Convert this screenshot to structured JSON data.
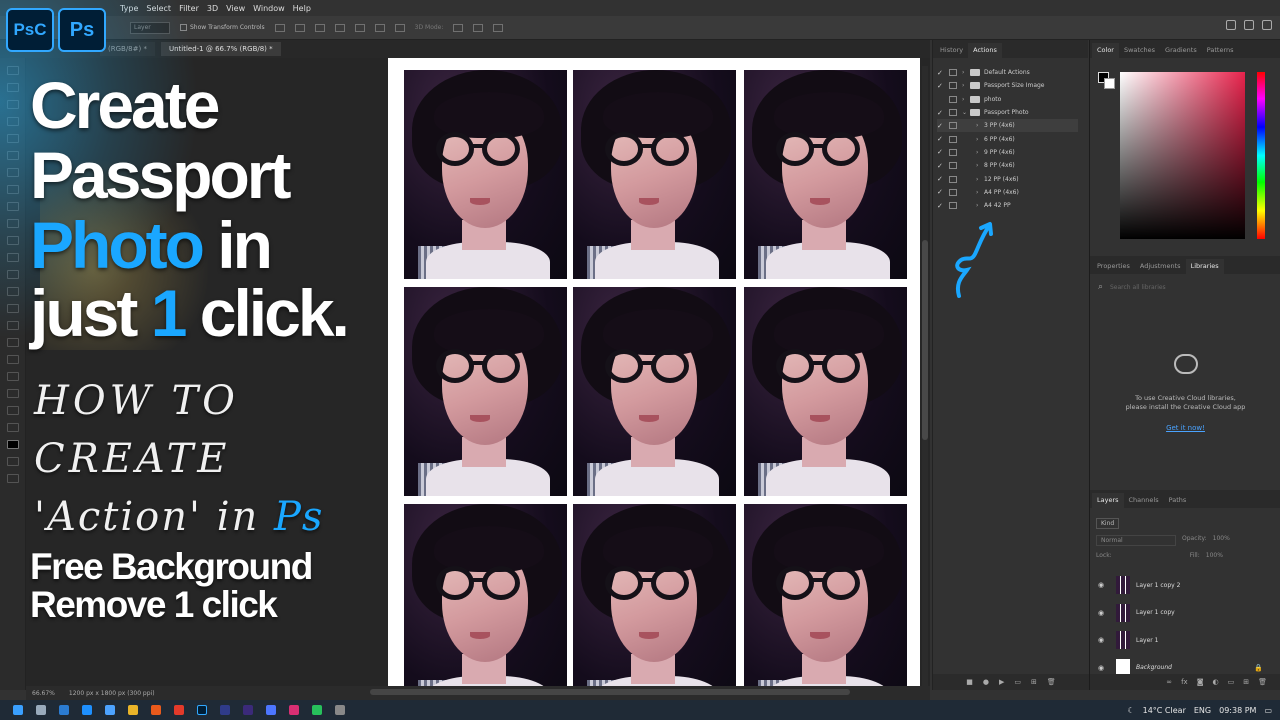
{
  "menu": {
    "items": [
      "Type",
      "Select",
      "Filter",
      "3D",
      "View",
      "Window",
      "Help"
    ]
  },
  "options_bar": {
    "layer_select": "Layer",
    "show_transform_controls": "Show Transform Controls",
    "mode_3d": "3D Mode:"
  },
  "tabs": [
    {
      "label": "(RGB/8#) *"
    },
    {
      "label": "Untitled-1 @ 66.7% (RGB/8) *"
    }
  ],
  "status": {
    "zoom": "66.67%",
    "doc_info": "1200 px x 1800 px (300 ppi)"
  },
  "overlay": {
    "badge_psc": "PsC",
    "badge_ps": "Ps",
    "title_line1": "Create",
    "title_line2": "Passport",
    "title_line3_a": "Ph",
    "title_line3_b": "oto",
    "title_line3_c": " in",
    "title_line4_a": "just ",
    "title_line4_b": "1",
    "title_line4_c": " click.",
    "how_line1": "HOW TO",
    "how_line2": "CREATE",
    "how_line3_a": "'Action' in ",
    "how_line3_b": "Ps",
    "free_line1": "Free Background",
    "free_line2": "Remove 1 click"
  },
  "actions_panel": {
    "tabs": [
      {
        "label": "History"
      },
      {
        "label": "Actions"
      }
    ],
    "rows": [
      {
        "label": "Default Actions",
        "type": "set",
        "checked": true
      },
      {
        "label": "Passport Size Image",
        "type": "set",
        "checked": true
      },
      {
        "label": "photo",
        "type": "set",
        "checked": false
      },
      {
        "label": "Passport Photo",
        "type": "set",
        "checked": true
      },
      {
        "label": "3 PP (4x6)",
        "type": "action",
        "checked": true
      },
      {
        "label": "6 PP (4x6)",
        "type": "action",
        "checked": true
      },
      {
        "label": "9 PP (4x6)",
        "type": "action",
        "checked": true
      },
      {
        "label": "8 PP (4x6)",
        "type": "action",
        "checked": true
      },
      {
        "label": "12 PP (4x6)",
        "type": "action",
        "checked": true
      },
      {
        "label": "A4 PP (4x6)",
        "type": "action",
        "checked": true
      },
      {
        "label": "A4 42 PP",
        "type": "action",
        "checked": true
      }
    ]
  },
  "color_panel": {
    "tabs": [
      {
        "label": "Color"
      },
      {
        "label": "Swatches"
      },
      {
        "label": "Gradients"
      },
      {
        "label": "Patterns"
      }
    ]
  },
  "libraries_panel": {
    "tabs": [
      {
        "label": "Properties"
      },
      {
        "label": "Adjustments"
      },
      {
        "label": "Libraries"
      }
    ],
    "search_placeholder": "Search all libraries",
    "message_line1": "To use Creative Cloud libraries,",
    "message_line2": "please install the Creative Cloud app",
    "link": "Get it now!"
  },
  "layers_panel": {
    "tabs": [
      {
        "label": "Layers"
      },
      {
        "label": "Channels"
      },
      {
        "label": "Paths"
      }
    ],
    "kind": "Kind",
    "blend": "Normal",
    "opacity_label": "Opacity:",
    "opacity": "100%",
    "lock_label": "Lock:",
    "fill_label": "Fill:",
    "fill": "100%",
    "layers": [
      {
        "name": "Layer 1 copy 2"
      },
      {
        "name": "Layer 1 copy"
      },
      {
        "name": "Layer 1"
      },
      {
        "name": "Background"
      }
    ]
  },
  "taskbar": {
    "weather": "14°C  Clear",
    "lang": "ENG",
    "time": "09:38 PM"
  },
  "colors": {
    "accent_blue": "#1aa7ff",
    "ps_badge": "#31a8ff",
    "link_blue": "#4aa3ff"
  }
}
